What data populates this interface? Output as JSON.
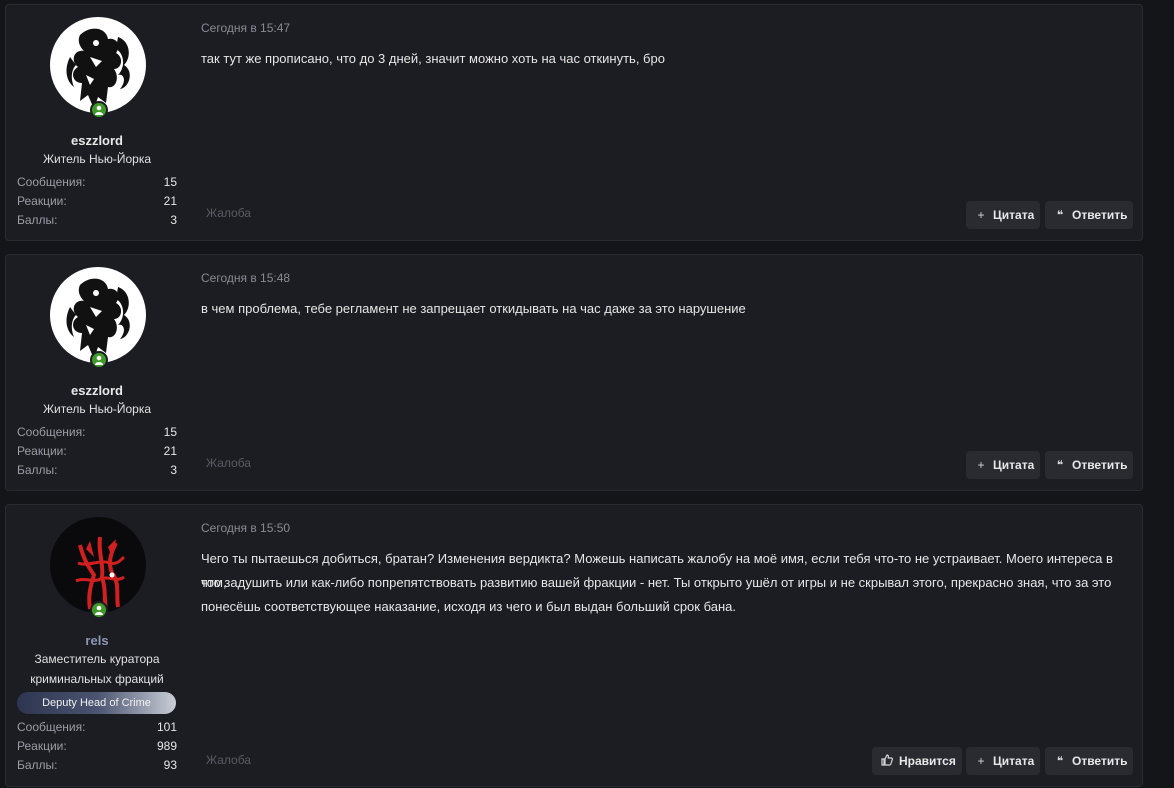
{
  "labels": {
    "messages": "Сообщения:",
    "reactions": "Реакции:",
    "points": "Баллы:",
    "report": "Жалоба",
    "quote": "Цитата",
    "reply": "Ответить",
    "like": "Нравится"
  },
  "posts": [
    {
      "username": "eszzlord",
      "user_title": "Житель Нью-Йорка",
      "messages": "15",
      "reactions": "21",
      "points": "3",
      "time": "Сегодня в 15:47",
      "text": "так тут же прописано, что до 3 дней, значит можно хоть на час откинуть, бро"
    },
    {
      "username": "eszzlord",
      "user_title": "Житель Нью-Йорка",
      "messages": "15",
      "reactions": "21",
      "points": "3",
      "time": "Сегодня в 15:48",
      "text": "в чем проблема, тебе регламент не запрещает откидывать на час даже за это нарушение"
    },
    {
      "username": "rels",
      "user_title_line1": "Заместитель куратора",
      "user_title_line2": "криминальных фракций",
      "banner": "Deputy Head of Crime",
      "messages": "101",
      "reactions": "989",
      "points": "93",
      "time": "Сегодня в 15:50",
      "text_line1": "Чего ты пытаешься добиться, братан? Изменения вердикта? Можешь написать жалобу на моё имя, если тебя что-то не устраивает. Моего интереса в том,",
      "text_line2": "что задушить или как-либо попрепятствовать развитию вашей фракции - нет. Ты открыто ушёл от игры и не скрывал этого, прекрасно зная, что за это",
      "text_line3": "понесёшь соответствующее наказание, исходя из чего и был выдан больший срок бана."
    }
  ],
  "icons": {
    "plus": "+",
    "quote": "❝",
    "like": "thumbs-up-icon"
  },
  "colors": {
    "background": "#141519",
    "post_bg": "#1c1d22",
    "online": "#3f9a2a",
    "rels_name": "#8d97b3",
    "button_bg": "#2a2b31"
  }
}
